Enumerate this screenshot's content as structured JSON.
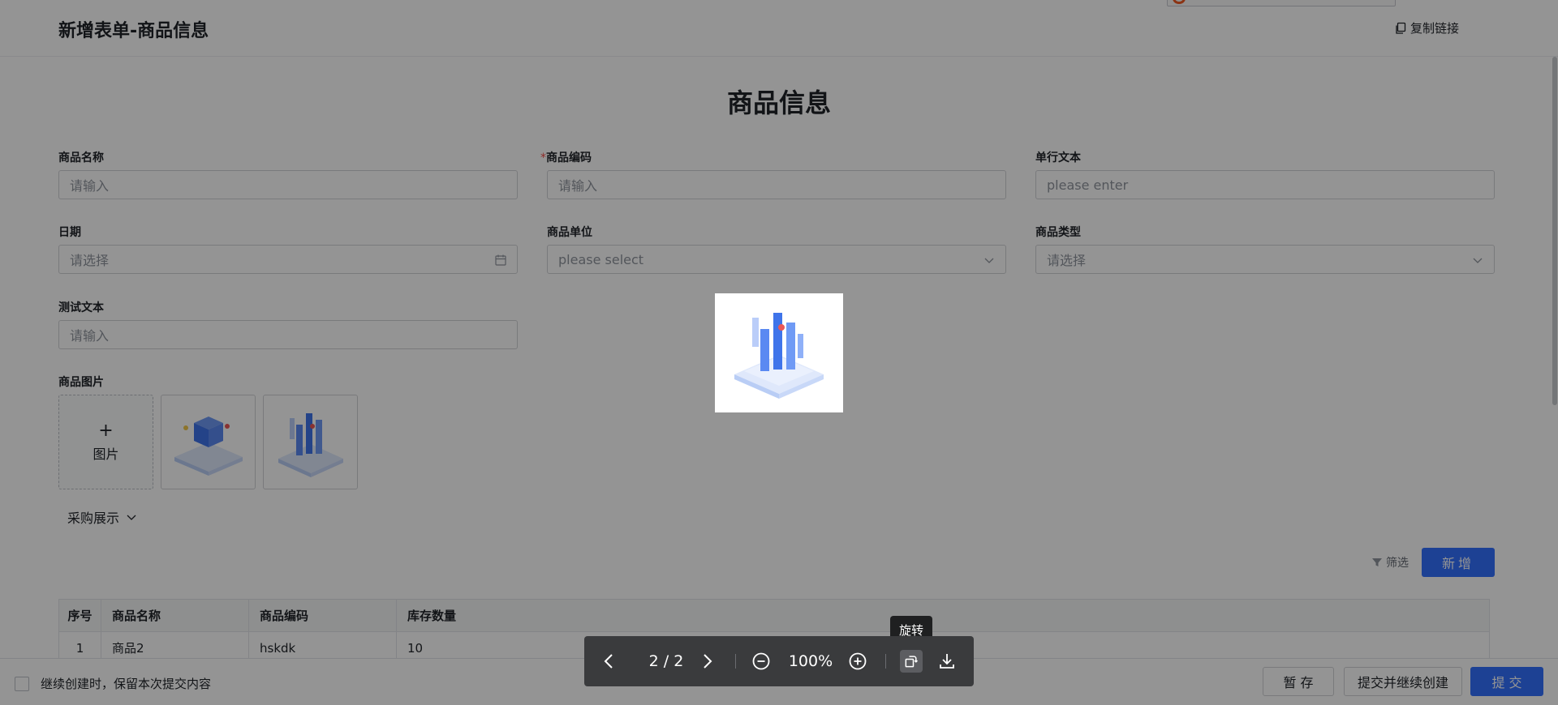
{
  "header": {
    "title": "新增表单-商品信息",
    "copy_link_label": "复制链接"
  },
  "form": {
    "title": "商品信息",
    "fields": [
      {
        "label": "商品名称",
        "required": false,
        "placeholder": "请输入"
      },
      {
        "label": "商品编码",
        "required": true,
        "placeholder": "请输入"
      },
      {
        "label": "单行文本",
        "required": false,
        "placeholder": "please enter"
      },
      {
        "label": "日期",
        "required": false,
        "placeholder": "请选择",
        "icon": "calendar-icon"
      },
      {
        "label": "商品单位",
        "required": false,
        "placeholder": "please select",
        "icon": "chevron-down-icon"
      },
      {
        "label": "商品类型",
        "required": false,
        "placeholder": "请选择",
        "icon": "chevron-down-icon"
      },
      {
        "label": "测试文本",
        "required": false,
        "placeholder": "请输入"
      }
    ],
    "required_mark": "*",
    "image_field": {
      "label": "商品图片",
      "upload_plus": "+",
      "upload_label": "图片",
      "thumbnails": [
        "cube-illustration",
        "bars-illustration"
      ]
    },
    "section_toggle": "采购展示"
  },
  "table_toolbar": {
    "filter_label": "筛选",
    "add_label": "新增"
  },
  "table": {
    "columns": [
      "序号",
      "商品名称",
      "商品编码",
      "库存数量"
    ],
    "rows": [
      [
        "1",
        "商品2",
        "hskdk",
        "10"
      ]
    ]
  },
  "footer": {
    "keep_label": "继续创建时，保留本次提交内容",
    "save_draft": "暂 存",
    "submit_continue": "提交并继续创建",
    "submit": "提 交"
  },
  "viewer": {
    "page_indicator": "2 / 2",
    "zoom": "100%",
    "tooltip": "旋转"
  },
  "colors": {
    "primary": "#3370ff",
    "required": "#f54a45",
    "toolbar_bg": "#3a3b3d"
  }
}
